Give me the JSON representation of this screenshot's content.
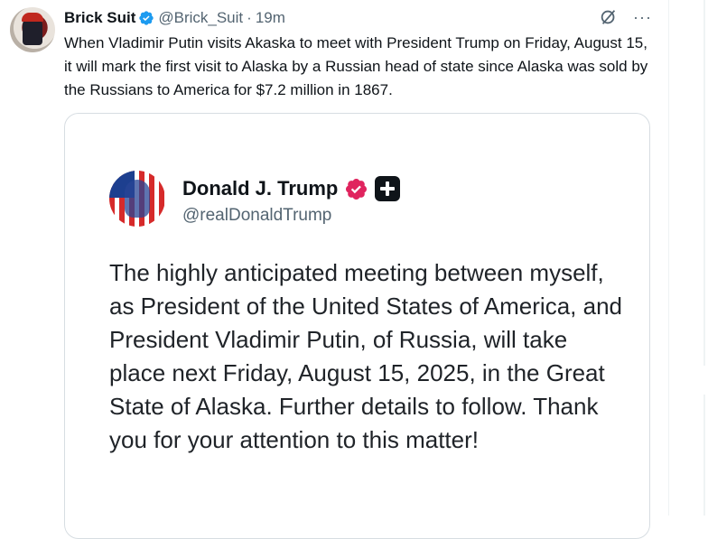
{
  "tweet": {
    "author_name": "Brick Suit",
    "author_handle": "@Brick_Suit",
    "separator": "·",
    "time": "19m",
    "text": "When Vladimir Putin visits Akaska to meet with President Trump on Friday, August 15, it will mark the first visit to Alaska by a Russian head of state since Alaska was sold by the Russians to America for $7.2 million in 1867.",
    "actions": [
      "grok-icon",
      "more-icon"
    ],
    "more_label": "···"
  },
  "embedded_post": {
    "name": "Donald J. Trump",
    "handle": "@realDonaldTrump",
    "text": "The highly anticipated meeting between myself, as President of the United States of America, and President Vladimir Putin, of Russia, will take place next Friday, August 15, 2025, in the Great State of Alaska. Further details to follow. Thank you for your attention to this matter!",
    "badge_color": "#e0245e",
    "plus_color": "#0f1419"
  },
  "colors": {
    "verified": "#1d9bf0",
    "text": "#0f1419",
    "secondary": "#536471",
    "border": "#d7dde2"
  }
}
